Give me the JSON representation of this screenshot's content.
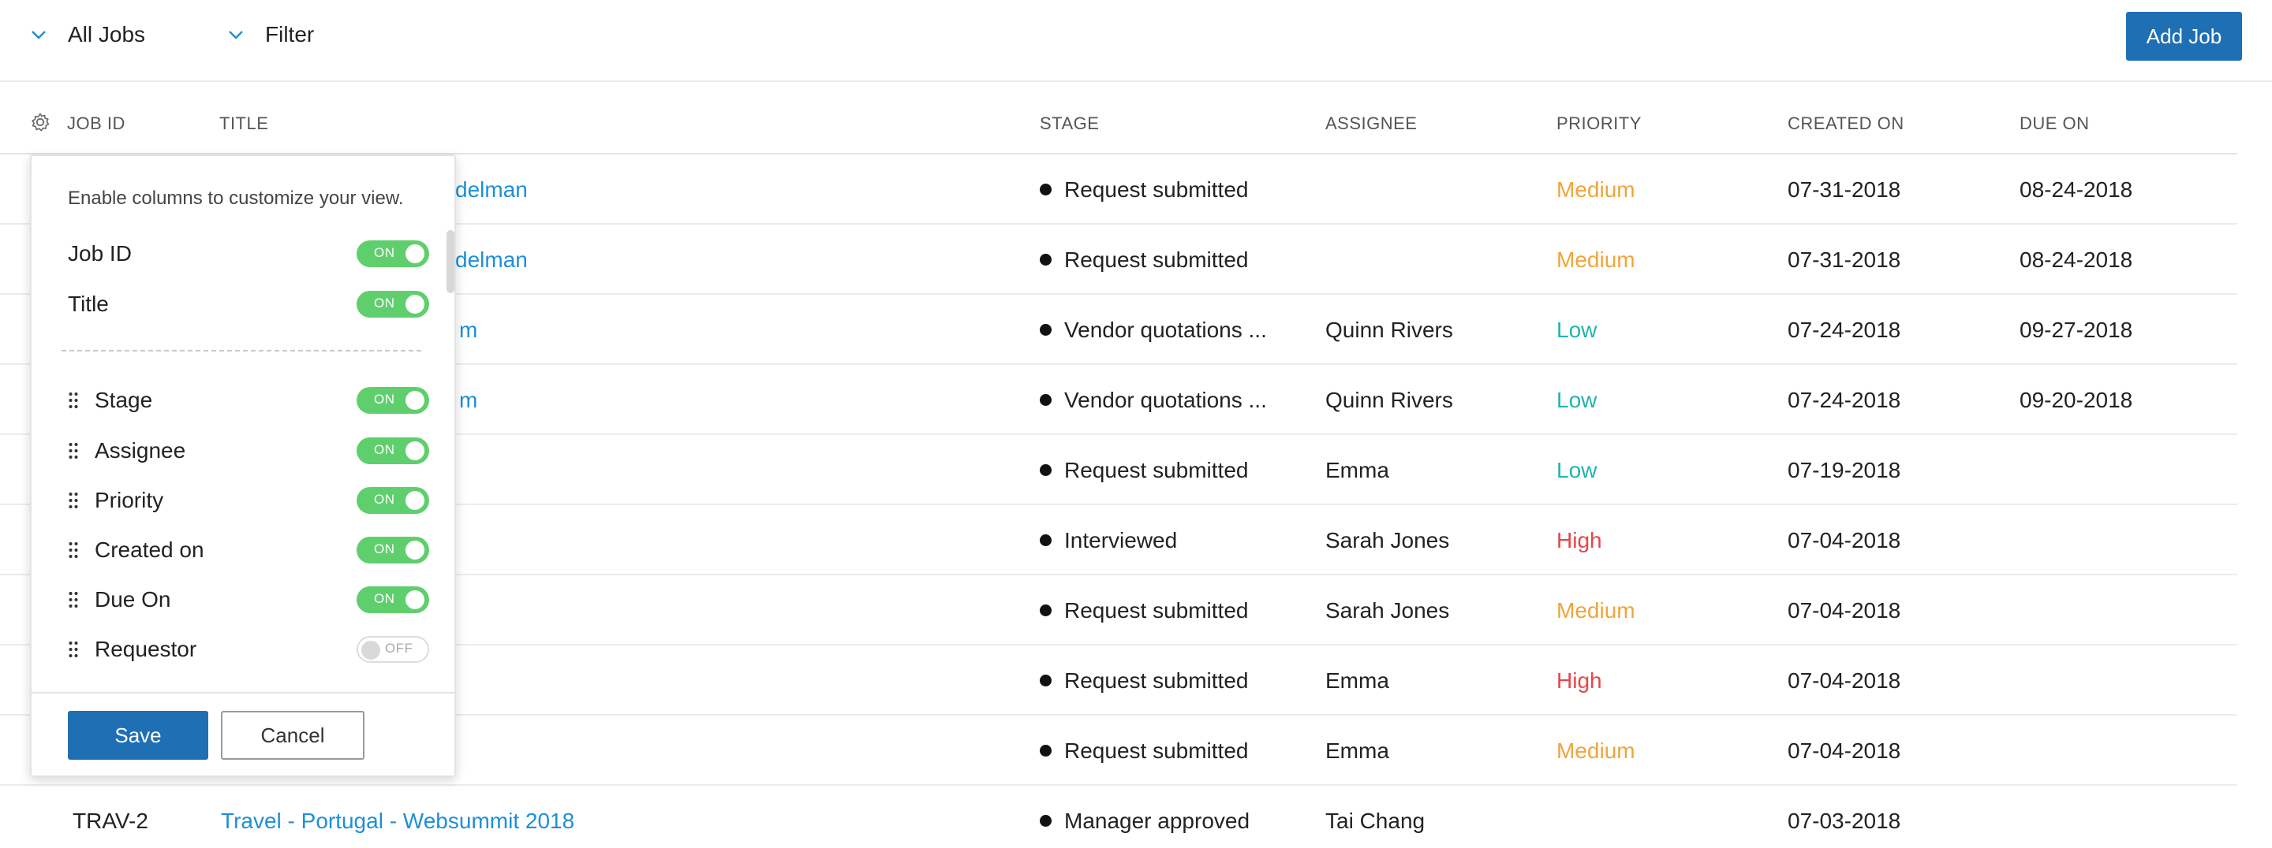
{
  "toolbar": {
    "view_label": "All Jobs",
    "filter_label": "Filter",
    "add_job_label": "Add Job"
  },
  "table": {
    "headers": {
      "job_id": "JOB ID",
      "title": "TITLE",
      "stage": "STAGE",
      "assignee": "ASSIGNEE",
      "priority": "PRIORITY",
      "created_on": "CREATED ON",
      "due_on": "DUE ON"
    },
    "rows": [
      {
        "job_id": "",
        "title": "delman",
        "stage": "Request submitted",
        "assignee": "",
        "priority": "Medium",
        "created_on": "07-31-2018",
        "due_on": "08-24-2018"
      },
      {
        "job_id": "",
        "title": "delman",
        "stage": "Request submitted",
        "assignee": "",
        "priority": "Medium",
        "created_on": "07-31-2018",
        "due_on": "08-24-2018"
      },
      {
        "job_id": "",
        "title": "m",
        "stage": "Vendor quotations ...",
        "assignee": "Quinn Rivers",
        "priority": "Low",
        "created_on": "07-24-2018",
        "due_on": "09-27-2018"
      },
      {
        "job_id": "",
        "title": "m",
        "stage": "Vendor quotations ...",
        "assignee": "Quinn Rivers",
        "priority": "Low",
        "created_on": "07-24-2018",
        "due_on": "09-20-2018"
      },
      {
        "job_id": "",
        "title": "",
        "stage": "Request submitted",
        "assignee": "Emma",
        "priority": "Low",
        "created_on": "07-19-2018",
        "due_on": ""
      },
      {
        "job_id": "",
        "title": "",
        "stage": "Interviewed",
        "assignee": "Sarah Jones",
        "priority": "High",
        "created_on": "07-04-2018",
        "due_on": ""
      },
      {
        "job_id": "",
        "title": "",
        "stage": "Request submitted",
        "assignee": "Sarah Jones",
        "priority": "Medium",
        "created_on": "07-04-2018",
        "due_on": ""
      },
      {
        "job_id": "",
        "title": "",
        "stage": "Request submitted",
        "assignee": "Emma",
        "priority": "High",
        "created_on": "07-04-2018",
        "due_on": ""
      },
      {
        "job_id": "",
        "title": "",
        "stage": "Request submitted",
        "assignee": "Emma",
        "priority": "Medium",
        "created_on": "07-04-2018",
        "due_on": ""
      },
      {
        "job_id": "TRAV-2",
        "title": "Travel - Portugal - Websummit 2018",
        "stage": "Manager approved",
        "assignee": "Tai Chang",
        "priority": "",
        "created_on": "07-03-2018",
        "due_on": ""
      }
    ]
  },
  "column_chooser": {
    "intro": "Enable columns to customize your view.",
    "fixed_columns": [
      {
        "label": "Job ID",
        "state": "ON"
      },
      {
        "label": "Title",
        "state": "ON"
      }
    ],
    "columns": [
      {
        "label": "Stage",
        "state": "ON"
      },
      {
        "label": "Assignee",
        "state": "ON"
      },
      {
        "label": "Priority",
        "state": "ON"
      },
      {
        "label": "Created on",
        "state": "ON"
      },
      {
        "label": "Due On",
        "state": "ON"
      },
      {
        "label": "Requestor",
        "state": "OFF"
      }
    ],
    "save_label": "Save",
    "cancel_label": "Cancel"
  },
  "colors": {
    "accent": "#1f6fb5",
    "link": "#1e8fd6",
    "toggle_on": "#5fcf6d",
    "priority_medium": "#efa53b",
    "priority_low": "#20b3b0",
    "priority_high": "#e8454a"
  },
  "icons": {
    "view_chevron": "chevron-down-icon",
    "filter_chevron": "chevron-down-icon",
    "column_settings": "gear-icon",
    "drag_handle": "drag-handle-icon"
  }
}
